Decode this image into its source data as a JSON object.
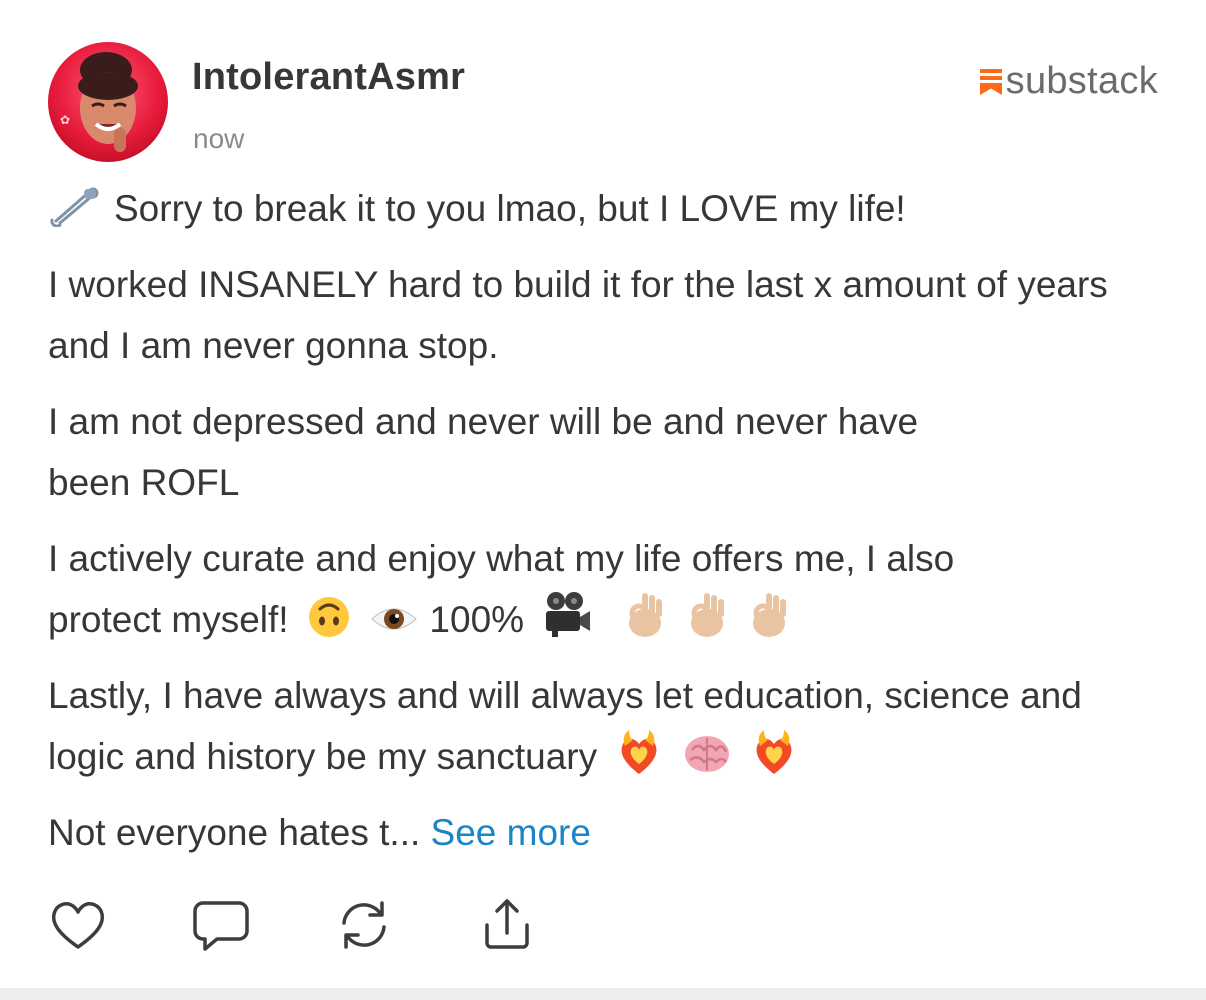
{
  "note": {
    "author": "IntolerantAsmr",
    "timestamp": "now",
    "brand": "substack",
    "accent_color": "#ff6719",
    "link_color": "#1a85c7",
    "paragraphs": {
      "p1": "Sorry to break it to you lmao, but I LOVE my life!",
      "p2": "I worked INSANELY hard to build it for the last x amount of years and I am never gonna stop.",
      "p3a": "I am not depressed and never will be and never have",
      "p3b": "been ROFL",
      "p4a": "I actively curate and enjoy what my life offers me, I also",
      "p4b": "protect myself!",
      "p4c": "100%",
      "p5": "Lastly, I have always and will always let education, science and logic and history be my sanctuary",
      "p6": "Not everyone hates t..."
    },
    "see_more": "See more",
    "icons": {
      "pin": "safety-pin-icon",
      "upside_down_face": "upside-down-face-emoji",
      "eye": "eye-emoji",
      "camera": "movie-camera-emoji",
      "ok_hand": "ok-hand-emoji",
      "heart_on_fire": "heart-on-fire-emoji",
      "brain": "brain-emoji"
    },
    "actions": [
      "like",
      "comment",
      "restack",
      "share"
    ]
  }
}
